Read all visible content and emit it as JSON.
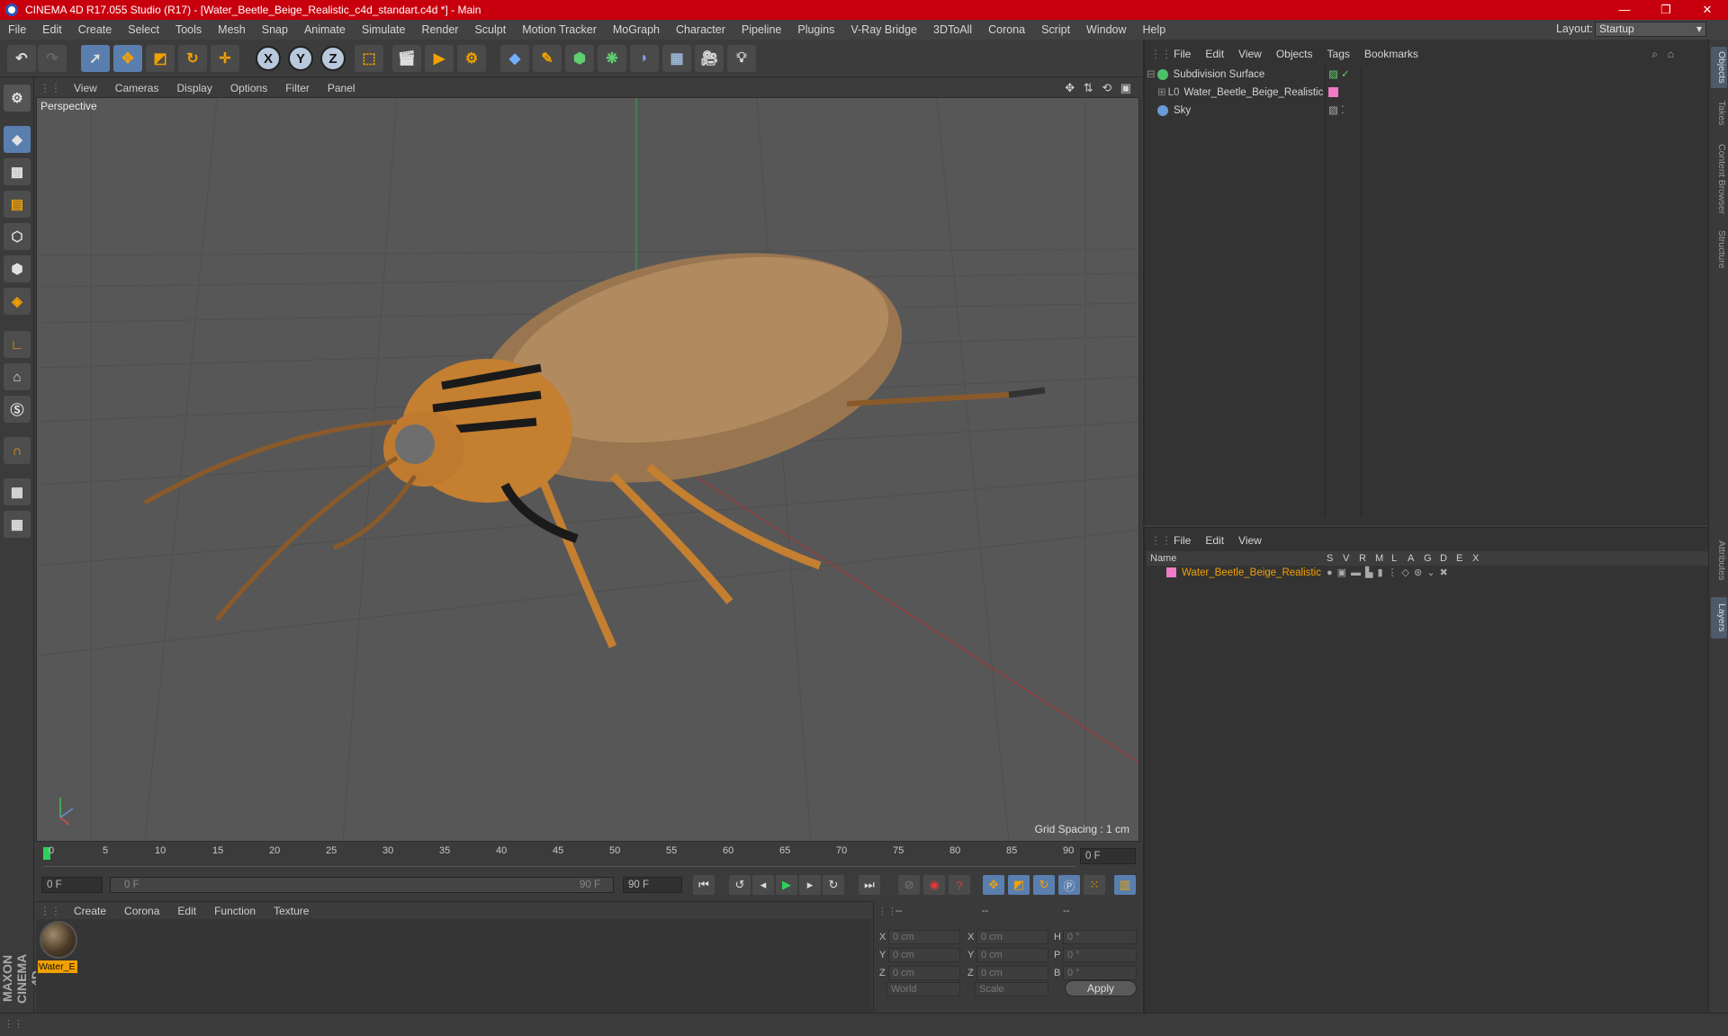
{
  "app": {
    "title": "CINEMA 4D R17.055 Studio (R17) - [Water_Beetle_Beige_Realistic_c4d_standart.c4d *] - Main",
    "window_controls": [
      "—",
      "❐",
      "✕"
    ]
  },
  "menubar": {
    "items": [
      "File",
      "Edit",
      "Create",
      "Select",
      "Tools",
      "Mesh",
      "Snap",
      "Animate",
      "Simulate",
      "Render",
      "Sculpt",
      "Motion Tracker",
      "MoGraph",
      "Character",
      "Pipeline",
      "Plugins",
      "V-Ray Bridge",
      "3DToAll",
      "Corona",
      "Script",
      "Window",
      "Help"
    ],
    "layout_label": "Layout:",
    "layout_value": "Startup"
  },
  "toolbar": {
    "axis_x": "X",
    "axis_y": "Y",
    "axis_z": "Z"
  },
  "viewport": {
    "menu": [
      "View",
      "Cameras",
      "Display",
      "Options",
      "Filter",
      "Panel"
    ],
    "nav_icons": "✥ ⇅ ⟲ ▣",
    "label": "Perspective",
    "grid_spacing": "Grid Spacing : 1 cm"
  },
  "timeline": {
    "ticks": [
      "0",
      "5",
      "10",
      "15",
      "20",
      "25",
      "30",
      "35",
      "40",
      "45",
      "50",
      "55",
      "60",
      "65",
      "70",
      "75",
      "80",
      "85",
      "90"
    ],
    "current_frame": "0 F",
    "start_field": "0 F",
    "range_start": "0 F",
    "range_end": "90 F",
    "end_field": "90 F"
  },
  "materials": {
    "menu": [
      "Create",
      "Corona",
      "Edit",
      "Function",
      "Texture"
    ],
    "items": [
      {
        "name": "Water_E"
      }
    ]
  },
  "coordinates": {
    "headers": [
      "--",
      "--",
      "--"
    ],
    "labels": [
      "X",
      "Y",
      "Z",
      "X",
      "Y",
      "Z",
      "H",
      "P",
      "B"
    ],
    "pos": [
      "0 cm",
      "0 cm",
      "0 cm"
    ],
    "size": [
      "0 cm",
      "0 cm",
      "0 cm"
    ],
    "rot": [
      "0 °",
      "0 °",
      "0 °"
    ],
    "mode_world": "World",
    "mode_scale": "Scale",
    "apply": "Apply"
  },
  "objects": {
    "menu": [
      "File",
      "Edit",
      "View",
      "Objects",
      "Tags",
      "Bookmarks"
    ],
    "items": [
      {
        "name": "Subdivision Surface"
      },
      {
        "name": "Water_Beetle_Beige_Realistic"
      },
      {
        "name": "Sky"
      }
    ]
  },
  "layers": {
    "menu": [
      "File",
      "Edit",
      "View"
    ],
    "columns": [
      "Name",
      "S",
      "V",
      "R",
      "M",
      "L",
      "A",
      "G",
      "D",
      "E",
      "X"
    ],
    "items": [
      {
        "name": "Water_Beetle_Beige_Realistic"
      }
    ]
  },
  "right_tabs": [
    "Objects",
    "Takes",
    "Content Browser",
    "Structure",
    "Attributes",
    "Layers"
  ],
  "brand": "MAXON CINEMA 4D",
  "colors": {
    "titlebar": "#c8000e",
    "accent_blue": "#5a7fae",
    "layer_orange": "#f0a000",
    "layer_pink": "#f07bc4"
  }
}
